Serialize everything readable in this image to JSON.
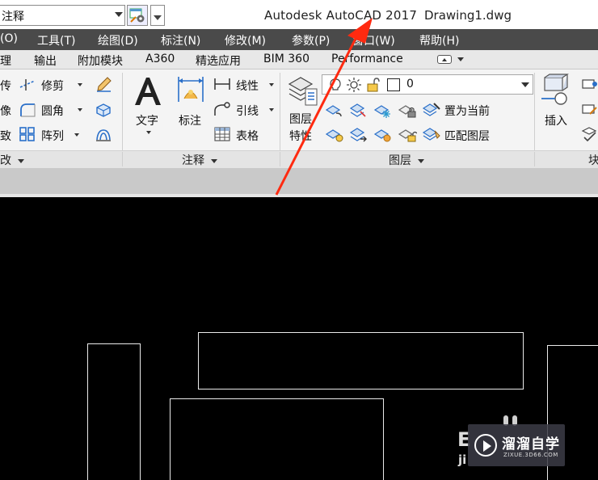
{
  "titlebar": {
    "workspace": "注释",
    "app_title": "Autodesk AutoCAD 2017",
    "file_name": "Drawing1.dwg"
  },
  "menu": {
    "items": [
      "(O)",
      "工具(T)",
      "绘图(D)",
      "标注(N)",
      "修改(M)",
      "参数(P)",
      "窗口(W)",
      "帮助(H)"
    ]
  },
  "tabs": {
    "items": [
      "理",
      "输出",
      "附加模块",
      "A360",
      "精选应用",
      "BIM 360",
      "Performance"
    ]
  },
  "modify_panel": {
    "rows": [
      "传",
      "像",
      "致"
    ],
    "trim": "修剪",
    "fillet": "圆角",
    "array": "阵列",
    "footer": "改"
  },
  "annotation_panel": {
    "text": "文字",
    "dimension": "标注",
    "linear": "线性",
    "leader": "引线",
    "table": "表格",
    "footer": "注释"
  },
  "layers_panel": {
    "properties_line1": "图层",
    "properties_line2": "特性",
    "current_layer": "0",
    "make_current": "置为当前",
    "match_layer": "匹配图层",
    "footer": "图层"
  },
  "block_panel": {
    "insert": "插入",
    "footer": "块"
  },
  "watermark": {
    "main": "溜溜自学",
    "sub": "ZIXUE.3D66.COM",
    "ghost": "E",
    "ghost2": "ji"
  },
  "colors": {
    "menubar": "#4a4a4a",
    "arrow": "#ff2a10",
    "canvas": "#000000"
  }
}
